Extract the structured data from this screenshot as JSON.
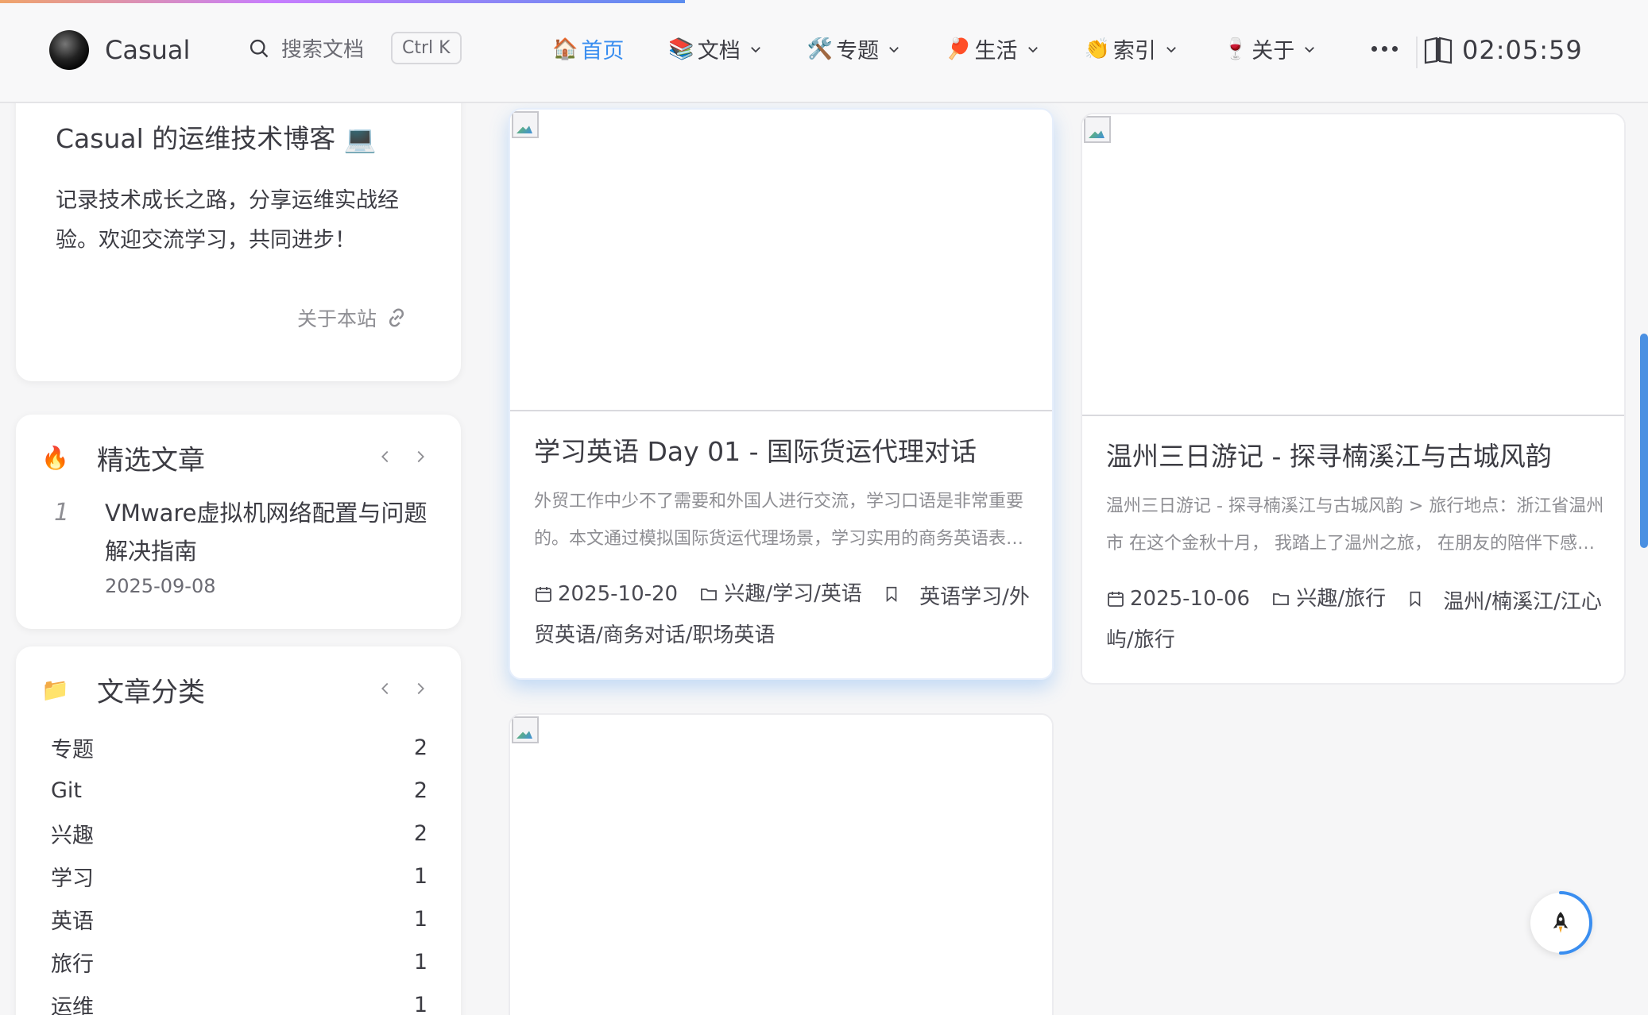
{
  "nav": {
    "site_name": "Casual",
    "search_label": "搜索文档",
    "search_shortcut": "Ctrl K",
    "menu": [
      {
        "emoji": "🏠",
        "label": "首页",
        "active": true,
        "dropdown": false
      },
      {
        "emoji": "📚",
        "label": "文档",
        "active": false,
        "dropdown": true
      },
      {
        "emoji": "🛠️",
        "label": "专题",
        "active": false,
        "dropdown": true
      },
      {
        "emoji": "🏓",
        "label": "生活",
        "active": false,
        "dropdown": true
      },
      {
        "emoji": "👏",
        "label": "索引",
        "active": false,
        "dropdown": true
      },
      {
        "emoji": "🍷",
        "label": "关于",
        "active": false,
        "dropdown": true
      }
    ],
    "clock": "02:05:59",
    "accent": "#3a8ef0"
  },
  "about": {
    "title": "Casual 的运维技术博客 💻",
    "desc": "记录技术成长之路，分享运维实战经验。欢迎交流学习，共同进步！",
    "link": "关于本站"
  },
  "featured": {
    "icon": "🔥",
    "title": "精选文章",
    "item": {
      "num": "1",
      "title": "VMware虚拟机网络配置与问题解决指南",
      "date": "2025-09-08"
    }
  },
  "categories": {
    "icon": "📁",
    "title": "文章分类",
    "items": [
      {
        "name": "专题",
        "count": "2"
      },
      {
        "name": "Git",
        "count": "2"
      },
      {
        "name": "兴趣",
        "count": "2"
      },
      {
        "name": "学习",
        "count": "1"
      },
      {
        "name": "英语",
        "count": "1"
      },
      {
        "name": "旅行",
        "count": "1"
      },
      {
        "name": "运维",
        "count": "1"
      }
    ]
  },
  "posts": [
    {
      "title": "学习英语 Day 01 - 国际货运代理对话",
      "desc": "外贸工作中少不了需要和外国人进行交流，学习口语是非常重要的。本文通过模拟国际货运代理场景，学习实用的商务英语表达。",
      "date": "2025-10-20",
      "category": "兴趣/学习/英语",
      "tags": "英语学习/外贸英语/商务对话/职场英语"
    },
    {
      "title": "温州三日游记 - 探寻楠溪江与古城风韵",
      "desc": "温州三日游记 - 探寻楠溪江与古城风韵 > 旅行地点：浙江省温州市 在这个金秋十月， 我踏上了温州之旅， 在朋友的陪伴下感受这座城市的魅力。",
      "date": "2025-10-06",
      "category": "兴趣/旅行",
      "tags": "温州/楠溪江/江心屿/旅行"
    }
  ]
}
